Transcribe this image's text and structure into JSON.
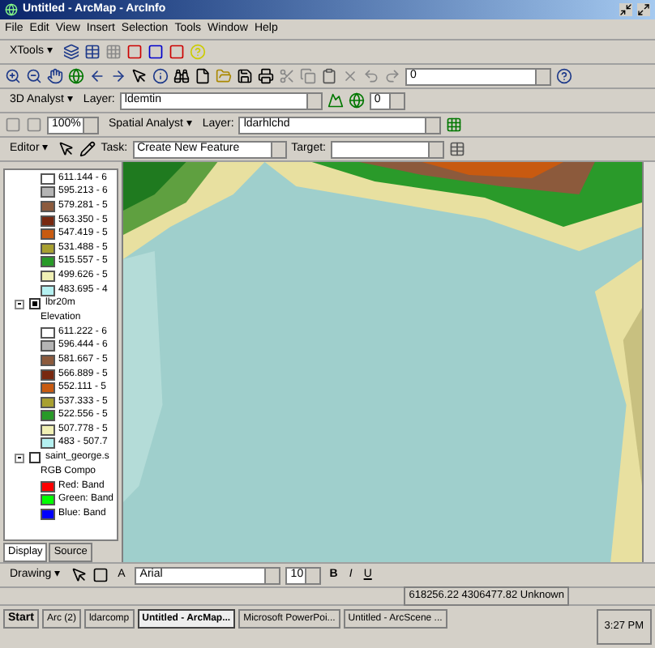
{
  "window": {
    "title": "Untitled - ArcMap - ArcInfo"
  },
  "menu": [
    "File",
    "Edit",
    "View",
    "Insert",
    "Selection",
    "Tools",
    "Window",
    "Help"
  ],
  "toolbars": {
    "xtools": {
      "menu": "XTools ▾"
    },
    "standard": {
      "scale": "0"
    },
    "analyst3d": {
      "menu": "3D Analyst ▾",
      "layer_label": "Layer:",
      "layer": "ldemtin",
      "spinner": "0"
    },
    "spatial": {
      "zoom": "100%",
      "menu": "Spatial Analyst ▾",
      "layer_label": "Layer:",
      "layer": "ldarhlchd"
    },
    "editor": {
      "menu": "Editor ▾",
      "task_label": "Task:",
      "task": "Create New Feature",
      "target_label": "Target:"
    }
  },
  "toc": {
    "items": [
      {
        "label": "611.144 - 6",
        "color": "#ffffff"
      },
      {
        "label": "595.213 - 6",
        "color": "#b4b4b4"
      },
      {
        "label": "579.281 - 5",
        "color": "#8c5a3c"
      },
      {
        "label": "563.350 - 5",
        "color": "#782810"
      },
      {
        "label": "547.419 - 5",
        "color": "#c85a10"
      },
      {
        "label": "531.488 - 5",
        "color": "#a8a030"
      },
      {
        "label": "515.557 - 5",
        "color": "#289a28"
      },
      {
        "label": "499.626 - 5",
        "color": "#f0f0b4"
      },
      {
        "label": "483.695 - 4",
        "color": "#b4f0f0"
      }
    ],
    "layers": [
      {
        "name": "lbr20m",
        "checked": true,
        "expanded": true,
        "sublabel": "Elevation",
        "items": [
          {
            "label": "611.222 - 6",
            "color": "#ffffff"
          },
          {
            "label": "596.444 - 6",
            "color": "#b4b4b4"
          },
          {
            "label": "581.667 - 5",
            "color": "#8c5a3c"
          },
          {
            "label": "566.889 - 5",
            "color": "#782810"
          },
          {
            "label": "552.111 - 5",
            "color": "#c85a10"
          },
          {
            "label": "537.333 - 5",
            "color": "#a8a030"
          },
          {
            "label": "522.556 - 5",
            "color": "#289a28"
          },
          {
            "label": "507.778 - 5",
            "color": "#f0f0b4"
          },
          {
            "label": "483 - 507.7",
            "color": "#b4f0f0"
          }
        ]
      },
      {
        "name": "saint_george.s",
        "checked": false,
        "expanded": true,
        "sublabel": "RGB Compo",
        "items": [
          {
            "label": "Red:  Band",
            "color": "#ff0000"
          },
          {
            "label": "Green: Band",
            "color": "#00ff00"
          },
          {
            "label": "Blue:  Band",
            "color": "#0000ff"
          }
        ]
      }
    ],
    "tabs": [
      {
        "label": "Display",
        "selected": true
      },
      {
        "label": "Source",
        "selected": false
      }
    ]
  },
  "drawing": {
    "menu": "Drawing ▾",
    "font": "Arial",
    "size": "10",
    "bold": "B",
    "italic": "I",
    "underline": "U",
    "text_tool": "A"
  },
  "status_bar": {
    "coordinates": "618256.22  4306477.82 Unknown"
  },
  "taskbar": {
    "start": "Start",
    "tasks": [
      {
        "label": "Arc (2)",
        "selected": false
      },
      {
        "label": "ldarcomp",
        "selected": false
      },
      {
        "label": "Untitled - ArcMap...",
        "selected": true
      },
      {
        "label": "Microsoft PowerPoi...",
        "selected": false
      },
      {
        "label": "Untitled - ArcScene ...",
        "selected": false
      }
    ],
    "clock": "3:27 PM"
  }
}
